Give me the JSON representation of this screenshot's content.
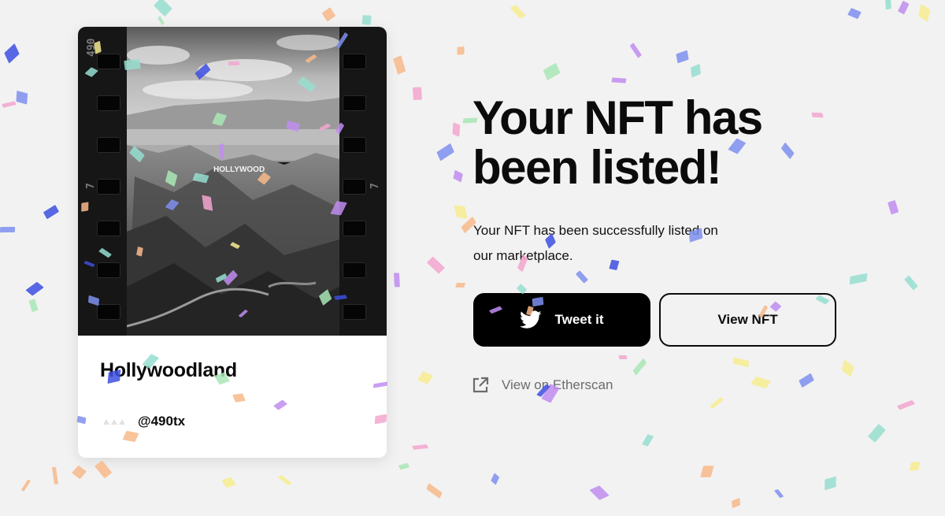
{
  "nft_card": {
    "title": "Hollywoodland",
    "creator_handle": "@490tx",
    "film_number": "490",
    "film_frame_marker": "7",
    "sign_text": "HOLLYWOOD",
    "image_icon": "hollywood-hills-photo"
  },
  "hero": {
    "headline": "Your NFT has been listed!",
    "description": "Your NFT has been successfully listed on our marketplace."
  },
  "actions": {
    "tweet_label": "Tweet it",
    "tweet_icon": "twitter-bird-icon",
    "view_nft_label": "View NFT",
    "etherscan_label": "View on Etherscan",
    "etherscan_icon": "external-link-icon"
  },
  "colors": {
    "background": "#f2f2f2",
    "primary_button": "#000000",
    "muted_text": "#6c6c6c",
    "confetti": [
      "#7f8ff0",
      "#c08df0",
      "#f3a6cf",
      "#f8b98a",
      "#a9e6b6",
      "#f7ec8f",
      "#97ded0",
      "#3d4fe0"
    ]
  }
}
